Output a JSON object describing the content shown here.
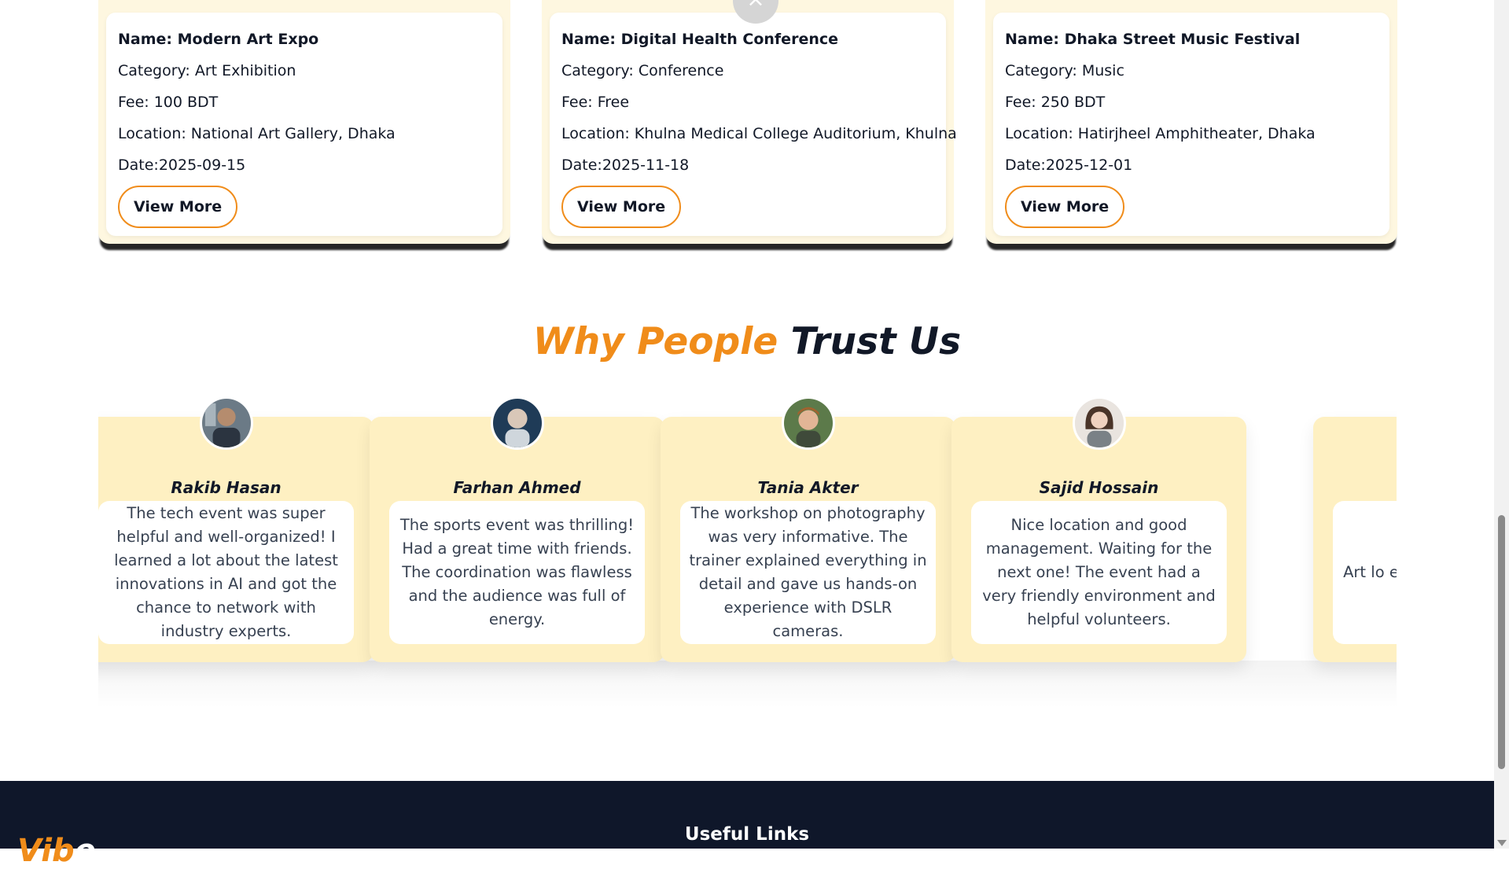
{
  "events": [
    {
      "name": "Name: Modern Art Expo",
      "category": "Category: Art Exhibition",
      "fee": "Fee: 100 BDT",
      "location": "Location: National Art Gallery, Dhaka",
      "date": "Date:2025-09-15",
      "button": "View More"
    },
    {
      "name": "Name: Digital Health Conference",
      "category": "Category: Conference",
      "fee": "Fee: Free",
      "location": "Location: Khulna Medical College Auditorium, Khulna",
      "date": "Date:2025-11-18",
      "button": "View More"
    },
    {
      "name": "Name: Dhaka Street Music Festival",
      "category": "Category: Music",
      "fee": "Fee: 250 BDT",
      "location": "Location: Hatirjheel Amphitheater, Dhaka",
      "date": "Date:2025-12-01",
      "button": "View More"
    }
  ],
  "close_glyph": "×",
  "trust": {
    "title_highlight": "Why People",
    "title_rest": "Trust Us",
    "testimonials": [
      {
        "name": "Rakib Hasan",
        "text": "The tech event was super helpful and well-organized! I learned a lot about the latest innovations in AI and got the chance to network with industry experts."
      },
      {
        "name": "Farhan Ahmed",
        "text": "The sports event was thrilling! Had a great time with friends. The coordination was flawless and the audience was full of energy."
      },
      {
        "name": "Tania Akter",
        "text": "The workshop on photography was very informative. The trainer explained everything in detail and gave us hands-on experience with DSLR cameras."
      },
      {
        "name": "Sajid Hossain",
        "text": "Nice location and good management. Waiting for the next one! The event had a very friendly environment and helpful volunteers."
      },
      {
        "name": "",
        "text": "Art lo exhibitio variety o displa"
      }
    ]
  },
  "footer": {
    "logo_part1": "Vib",
    "logo_part2": "e",
    "useful_links": "Useful Links"
  },
  "colors": {
    "accent": "#f08c1a",
    "card_bg": "#fef0c2",
    "footer_bg": "#0f172a"
  }
}
